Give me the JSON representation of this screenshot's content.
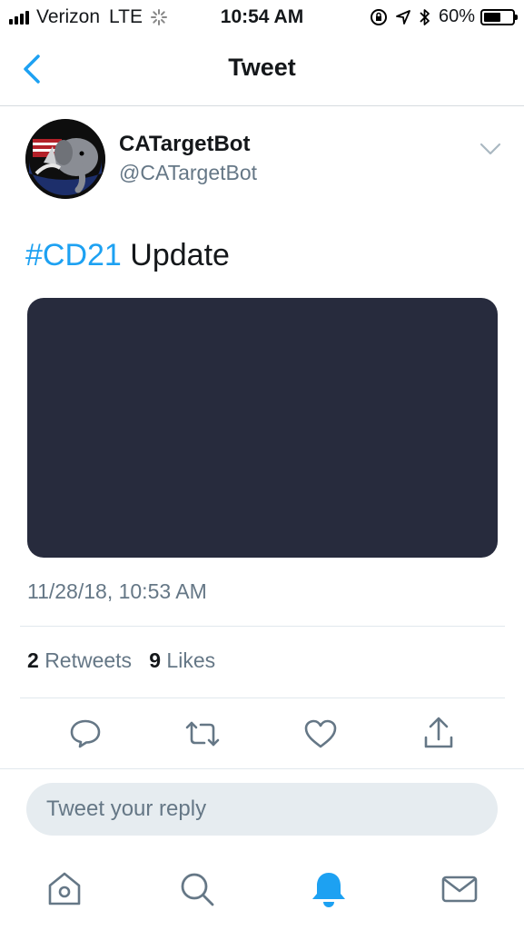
{
  "status_bar": {
    "carrier": "Verizon",
    "network": "LTE",
    "time": "10:54 AM",
    "battery_percent": "60%",
    "battery_level": 0.6
  },
  "nav": {
    "title": "Tweet",
    "back_icon": "chevron-left-icon"
  },
  "tweet": {
    "display_name": "CATargetBot",
    "handle": "@CATargetBot",
    "hashtag": "#CD21",
    "text": " Update",
    "timestamp": "11/28/18, 10:53 AM",
    "retweets_count": "2",
    "retweets_label": "Retweets",
    "likes_count": "9",
    "likes_label": "Likes"
  },
  "actions": [
    "reply-icon",
    "retweet-icon",
    "like-icon",
    "share-icon"
  ],
  "reply": {
    "placeholder": "Tweet your reply"
  },
  "tab_bar": [
    "home-icon",
    "search-icon",
    "notifications-icon",
    "messages-icon"
  ],
  "colors": {
    "accent": "#1da1f2",
    "secondary_text": "#657786",
    "media_background": "#272b3d"
  }
}
